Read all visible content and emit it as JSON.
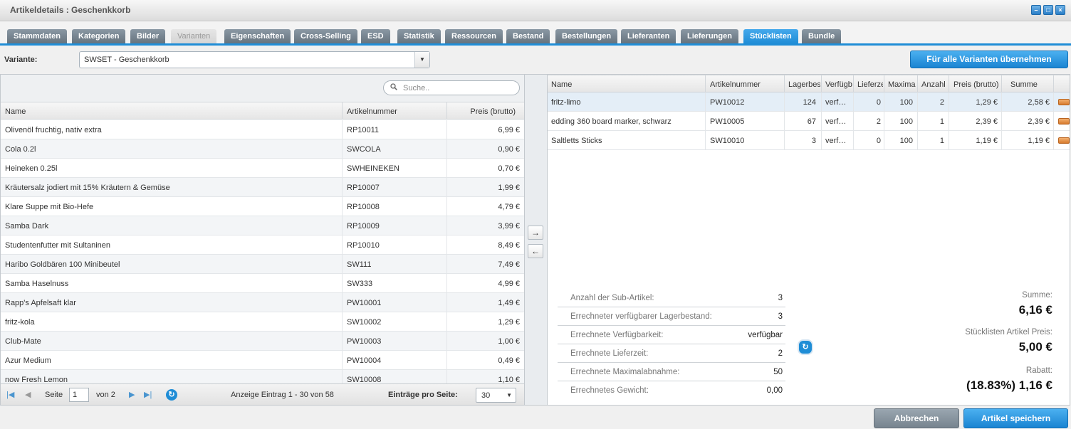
{
  "window": {
    "title": "Artikeldetails : Geschenkkorb"
  },
  "tabs": [
    "Stammdaten",
    "Kategorien",
    "Bilder",
    "Varianten",
    "Eigenschaften",
    "Cross-Selling",
    "ESD",
    "Statistik",
    "Ressourcen",
    "Bestand",
    "Bestellungen",
    "Lieferanten",
    "Lieferungen",
    "Stücklisten",
    "Bundle"
  ],
  "variant": {
    "label": "Variante:",
    "selected": "SWSET - Geschenkkorb",
    "apply_all_label": "Für alle Varianten übernehmen"
  },
  "left_grid": {
    "search_placeholder": "Suche..",
    "columns": [
      "Name",
      "Artikelnummer",
      "Preis (brutto)"
    ],
    "rows": [
      {
        "name": "Olivenöl fruchtig, nativ extra",
        "number": "RP10011",
        "price": "6,99 €"
      },
      {
        "name": "Cola 0.2l",
        "number": "SWCOLA",
        "price": "0,90 €"
      },
      {
        "name": "Heineken 0.25l",
        "number": "SWHEINEKEN",
        "price": "0,70 €"
      },
      {
        "name": "Kräutersalz jodiert mit 15% Kräutern & Gemüse",
        "number": "RP10007",
        "price": "1,99 €"
      },
      {
        "name": "Klare Suppe mit Bio-Hefe",
        "number": "RP10008",
        "price": "4,79 €"
      },
      {
        "name": "Samba Dark",
        "number": "RP10009",
        "price": "3,99 €"
      },
      {
        "name": "Studentenfutter mit Sultaninen",
        "number": "RP10010",
        "price": "8,49 €"
      },
      {
        "name": "Haribo Goldbären 100 Minibeutel",
        "number": "SW111",
        "price": "7,49 €"
      },
      {
        "name": "Samba Haselnuss",
        "number": "SW333",
        "price": "4,99 €"
      },
      {
        "name": "Rapp's Apfelsaft klar",
        "number": "PW10001",
        "price": "1,49 €"
      },
      {
        "name": "fritz-kola",
        "number": "SW10002",
        "price": "1,29 €"
      },
      {
        "name": "Club-Mate",
        "number": "PW10003",
        "price": "1,00 €"
      },
      {
        "name": "Azur Medium",
        "number": "PW10004",
        "price": "0,49 €"
      },
      {
        "name": "now Fresh Lemon",
        "number": "SW10008",
        "price": "1,10 €"
      }
    ],
    "pager": {
      "page_label": "Seite",
      "page": "1",
      "of_label": "von 2",
      "display": "Anzeige Eintrag 1 - 30 von 58",
      "per_page_label": "Einträge pro Seite:",
      "per_page": "30"
    }
  },
  "right_grid": {
    "columns": [
      "Name",
      "Artikelnummer",
      "Lagerbes",
      "Verfügb",
      "Lieferze",
      "Maxima",
      "Anzahl",
      "Preis (brutto)",
      "Summe"
    ],
    "rows": [
      {
        "name": "fritz-limo",
        "number": "PW10012",
        "stock": "124",
        "avail": "verf…",
        "delivery": "0",
        "max": "100",
        "qty": "2",
        "price": "1,29 €",
        "sum": "2,58 €"
      },
      {
        "name": "edding 360 board marker, schwarz",
        "number": "PW10005",
        "stock": "67",
        "avail": "verf…",
        "delivery": "2",
        "max": "100",
        "qty": "1",
        "price": "2,39 €",
        "sum": "2,39 €"
      },
      {
        "name": "Saltletts Sticks",
        "number": "SW10010",
        "stock": "3",
        "avail": "verf…",
        "delivery": "0",
        "max": "100",
        "qty": "1",
        "price": "1,19 €",
        "sum": "1,19 €"
      }
    ],
    "stats": [
      {
        "label": "Anzahl der Sub-Artikel:",
        "value": "3"
      },
      {
        "label": "Errechneter verfügbarer Lagerbestand:",
        "value": "3"
      },
      {
        "label": "Errechnete Verfügbarkeit:",
        "value": "verfügbar"
      },
      {
        "label": "Errechnete Lieferzeit:",
        "value": "2"
      },
      {
        "label": "Errechnete Maximalabnahme:",
        "value": "50"
      },
      {
        "label": "Errechnetes Gewicht:",
        "value": "0,00"
      }
    ],
    "totals": {
      "sum_label": "Summe:",
      "sum_value": "6,16 €",
      "bom_price_label": "Stücklisten Artikel Preis:",
      "bom_price_value": "5,00 €",
      "discount_label": "Rabatt:",
      "discount_value": "(18.83%) 1,16 €"
    }
  },
  "footer": {
    "cancel_label": "Abbrechen",
    "save_label": "Artikel speichern"
  },
  "colors": {
    "accent": "#1f8dd6",
    "tab_grey": "#77848f"
  },
  "icons": [
    "minimize-icon",
    "maximize-icon",
    "close-icon",
    "search-icon",
    "dropdown-arrow-icon",
    "first-page-icon",
    "prev-page-icon",
    "next-page-icon",
    "last-page-icon",
    "refresh-icon",
    "arrow-right-icon",
    "arrow-left-icon",
    "edit-icon"
  ]
}
